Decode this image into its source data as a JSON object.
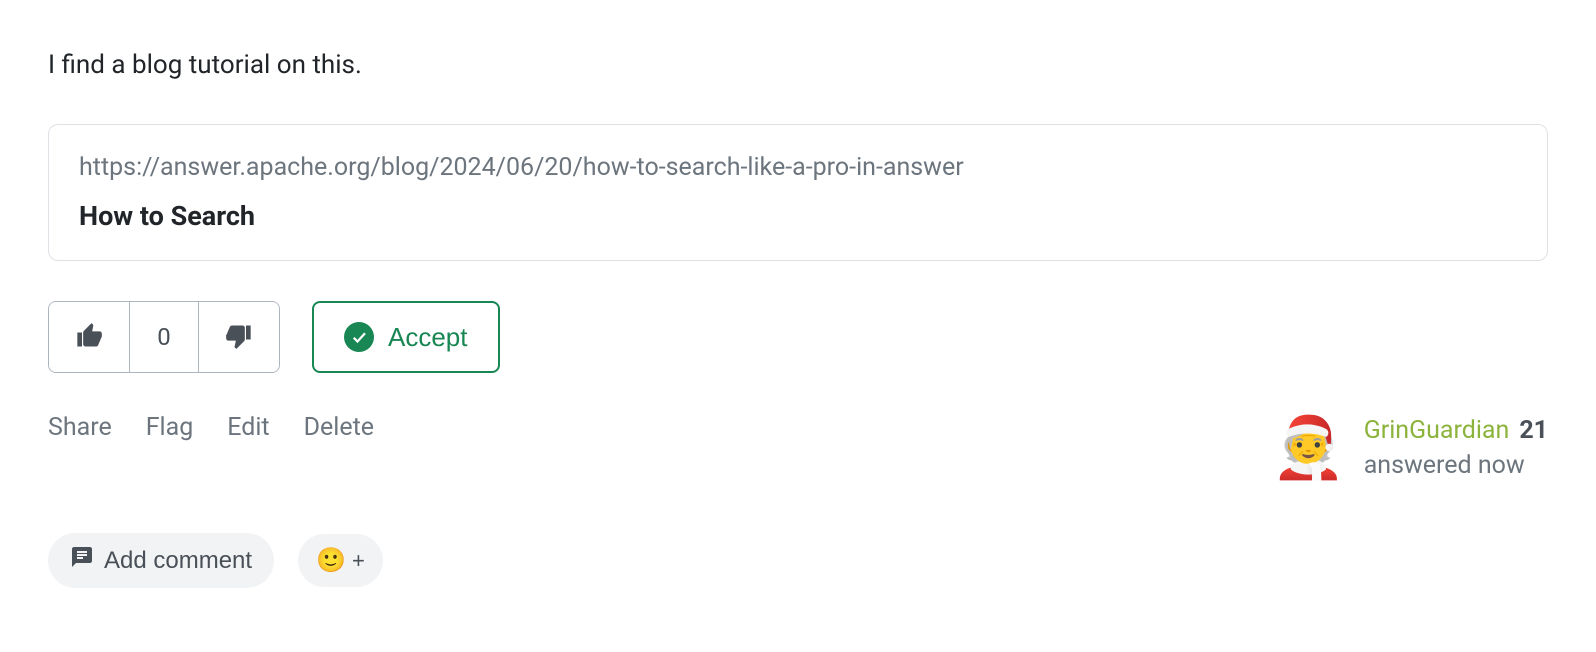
{
  "answer": {
    "body_text": "I find a blog tutorial on this.",
    "link_preview": {
      "url": "https://answer.apache.org/blog/2024/06/20/how-to-search-like-a-pro-in-answer",
      "title": "How to Search"
    },
    "vote_count": "0",
    "accept_label": "Accept"
  },
  "meta_links": {
    "share": "Share",
    "flag": "Flag",
    "edit": "Edit",
    "delete": "Delete"
  },
  "author": {
    "name": "GrinGuardian",
    "reputation": "21",
    "answered_label": "answered now",
    "avatar_emoji": "🧑‍🎄"
  },
  "comment": {
    "add_label": "Add comment",
    "reaction_emoji": "🙂",
    "reaction_plus": "+"
  }
}
